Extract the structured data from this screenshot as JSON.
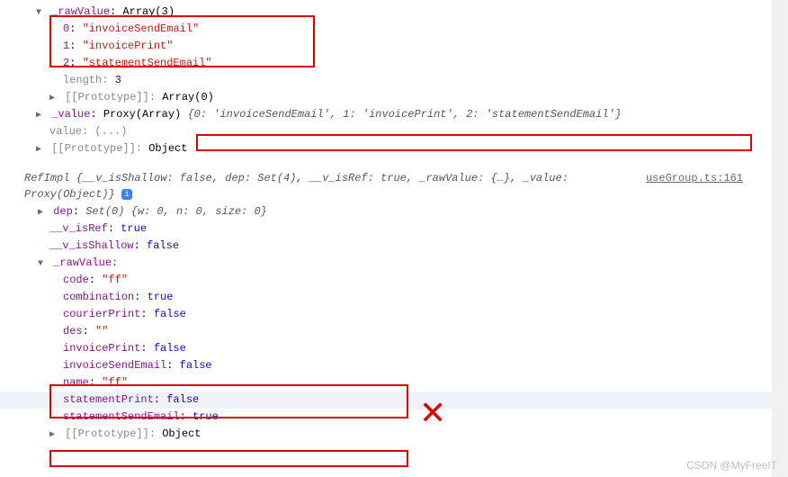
{
  "topBlock": {
    "rawValueHeader": {
      "key": "_rawValue",
      "val": "Array(3)"
    },
    "items": [
      {
        "k": "0",
        "v": "\"invoiceSendEmail\""
      },
      {
        "k": "1",
        "v": "\"invoicePrint\""
      },
      {
        "k": "2",
        "v": "\"statementSendEmail\""
      }
    ],
    "length": {
      "k": "length",
      "v": "3"
    },
    "proto1": {
      "k": "[[Prototype]]",
      "v": "Array(0)"
    },
    "valueLine": {
      "k": "_value",
      "pre": "Proxy(Array) ",
      "bracket": "{0: 'invoiceSendEmail', 1: 'invoicePrint', 2: 'statementSendEmail'}"
    },
    "valueGetter": {
      "k": "value",
      "v": "(...)"
    },
    "proto2": {
      "k": "[[Prototype]]",
      "v": "Object"
    }
  },
  "bottomBlock": {
    "sourceLink": "useGroup.ts:161",
    "summaryLine": "RefImpl {__v_isShallow: false, dep: Set(4), __v_isRef: true, _rawValue: {…}, _value: Proxy(Object)}",
    "dep": {
      "k": "dep",
      "v": "Set(0) {w: 0, n: 0, size: 0}"
    },
    "isRef": {
      "k": "__v_isRef",
      "v": "true"
    },
    "isShallow": {
      "k": "__v_isShallow",
      "v": "false"
    },
    "rawValueHeader": "_rawValue:",
    "props": {
      "code": {
        "k": "code",
        "v": "\"ff\""
      },
      "combination": {
        "k": "combination",
        "v": "true"
      },
      "courierPrint": {
        "k": "courierPrint",
        "v": "false"
      },
      "des": {
        "k": "des",
        "v": "\"\""
      },
      "invoicePrint": {
        "k": "invoicePrint",
        "v": "false"
      },
      "invoiceSendEmail": {
        "k": "invoiceSendEmail",
        "v": "false"
      },
      "name": {
        "k": "name",
        "v": "\"ff\""
      },
      "statementPrint": {
        "k": "statementPrint",
        "v": "false"
      },
      "statementSendEmail": {
        "k": "statementSendEmail",
        "v": "true"
      }
    },
    "proto": {
      "k": "[[Prototype]]",
      "v": "Object"
    }
  },
  "watermark": "CSDN @MyFreeIT"
}
